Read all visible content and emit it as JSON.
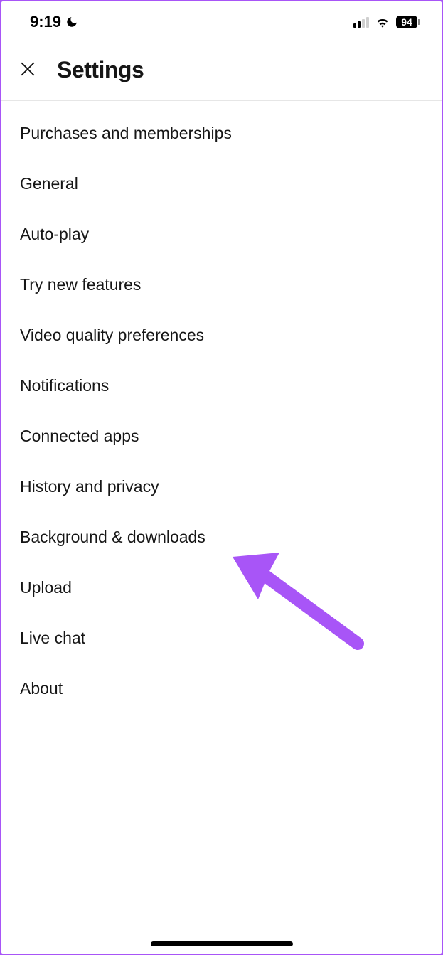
{
  "status": {
    "time": "9:19",
    "battery": "94"
  },
  "header": {
    "title": "Settings"
  },
  "menu": {
    "items": [
      {
        "label": "Purchases and memberships",
        "name": "menu-item-purchases"
      },
      {
        "label": "General",
        "name": "menu-item-general"
      },
      {
        "label": "Auto-play",
        "name": "menu-item-auto-play"
      },
      {
        "label": "Try new features",
        "name": "menu-item-try-new-features"
      },
      {
        "label": "Video quality preferences",
        "name": "menu-item-video-quality"
      },
      {
        "label": "Notifications",
        "name": "menu-item-notifications"
      },
      {
        "label": "Connected apps",
        "name": "menu-item-connected-apps"
      },
      {
        "label": "History and privacy",
        "name": "menu-item-history-privacy"
      },
      {
        "label": "Background & downloads",
        "name": "menu-item-background-downloads"
      },
      {
        "label": "Upload",
        "name": "menu-item-upload"
      },
      {
        "label": "Live chat",
        "name": "menu-item-live-chat"
      },
      {
        "label": "About",
        "name": "menu-item-about"
      }
    ]
  },
  "annotation": {
    "arrow_color": "#a855f7"
  }
}
